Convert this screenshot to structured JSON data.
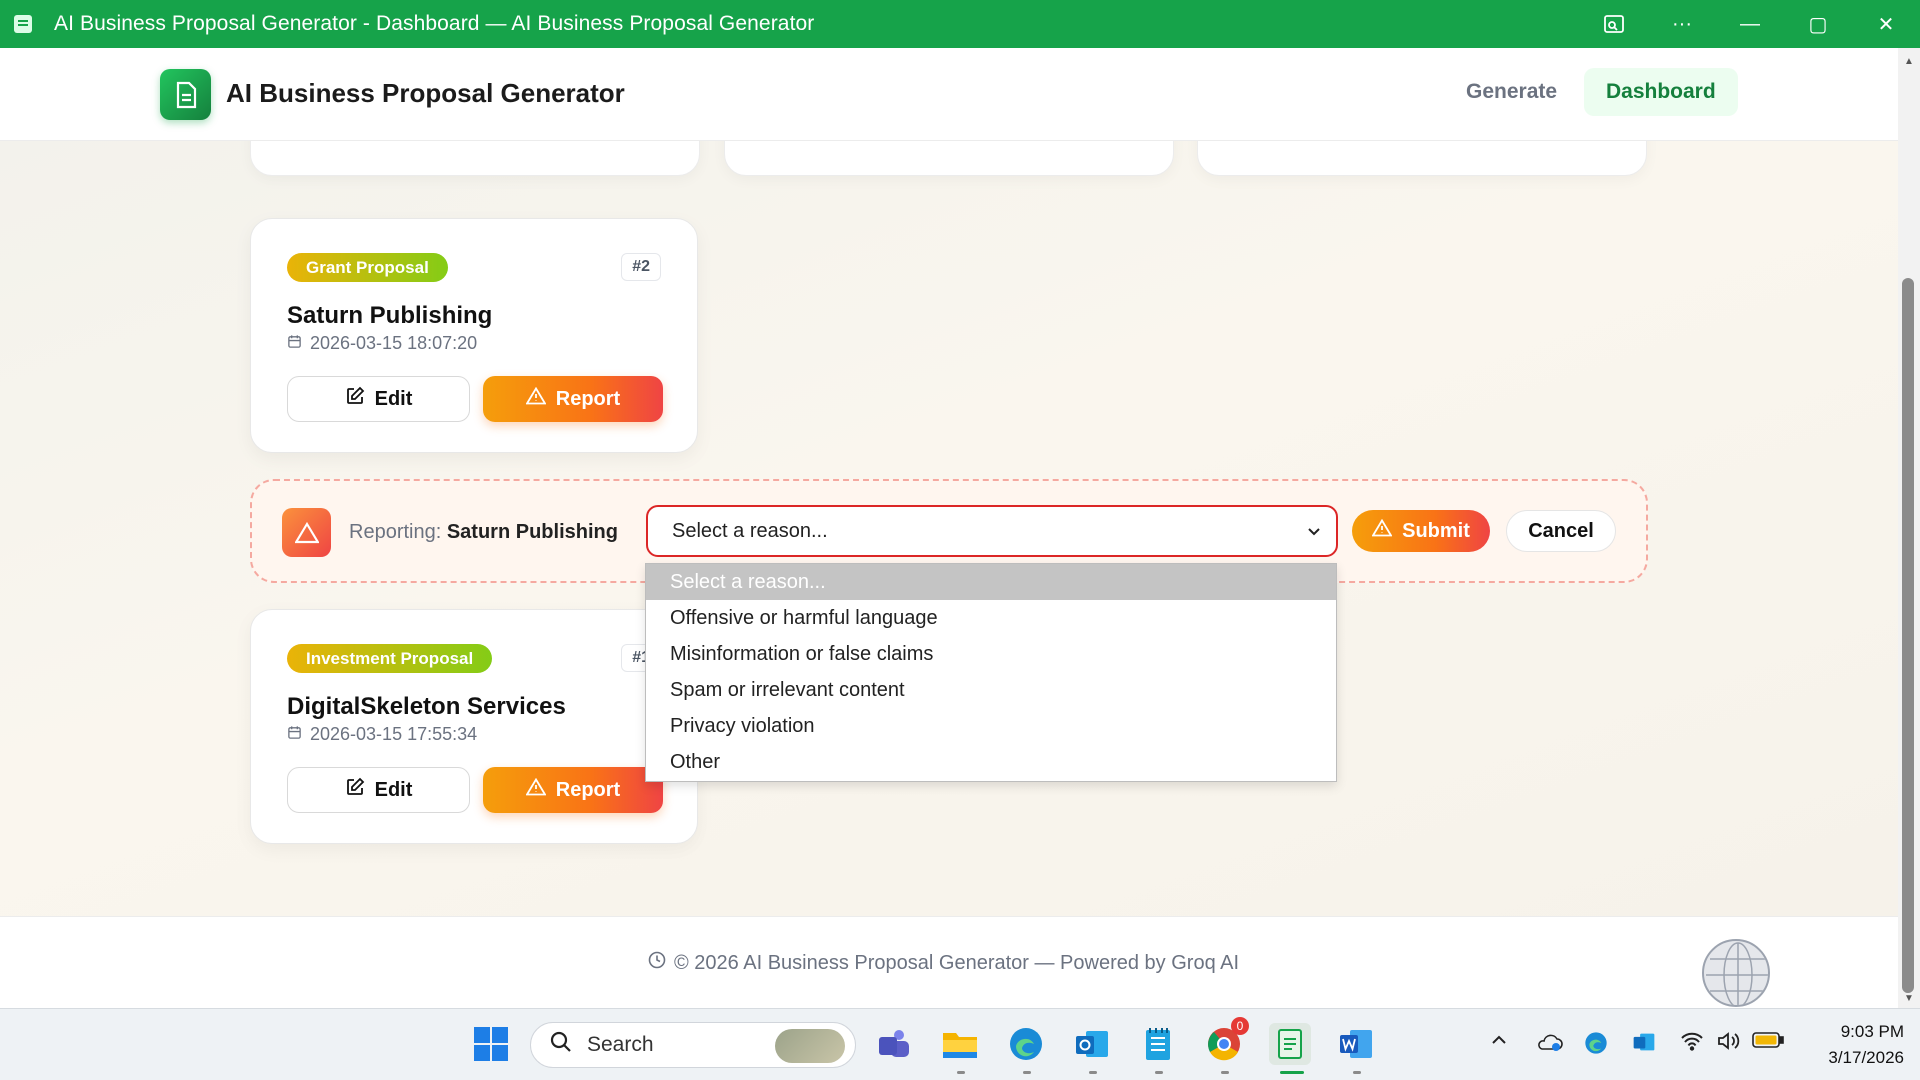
{
  "window": {
    "title": "AI Business Proposal Generator - Dashboard — AI Business Proposal Generator",
    "controls": {
      "minimize": "—",
      "maximize": "▢",
      "close": "✕",
      "more": "···"
    }
  },
  "header": {
    "brand": "AI Business Proposal Generator",
    "nav": {
      "generate": "Generate",
      "dashboard": "Dashboard"
    }
  },
  "cards": [
    {
      "badge": "Grant Proposal",
      "id": "#2",
      "title": "Saturn Publishing",
      "date": "2026-03-15 18:07:20",
      "edit_label": "Edit",
      "report_label": "Report"
    },
    {
      "badge": "Investment Proposal",
      "id": "#1",
      "title": "DigitalSkeleton Services",
      "date": "2026-03-15 17:55:34",
      "edit_label": "Edit",
      "report_label": "Report"
    }
  ],
  "report_bar": {
    "prefix": "Reporting:",
    "target": "Saturn Publishing",
    "select_value": "Select a reason...",
    "submit_label": "Submit",
    "cancel_label": "Cancel"
  },
  "dropdown": {
    "options": [
      "Select a reason...",
      "Offensive or harmful language",
      "Misinformation or false claims",
      "Spam or irrelevant content",
      "Privacy violation",
      "Other"
    ]
  },
  "footer": {
    "text": "© 2026 AI Business Proposal Generator — Powered by Groq AI"
  },
  "taskbar": {
    "search_label": "Search",
    "chrome_badge": "0",
    "clock_time": "9:03 PM",
    "clock_date": "3/17/2026"
  },
  "colors": {
    "accent": "#16a34a",
    "report_gradient": "#f97316",
    "danger": "#dc2626"
  }
}
